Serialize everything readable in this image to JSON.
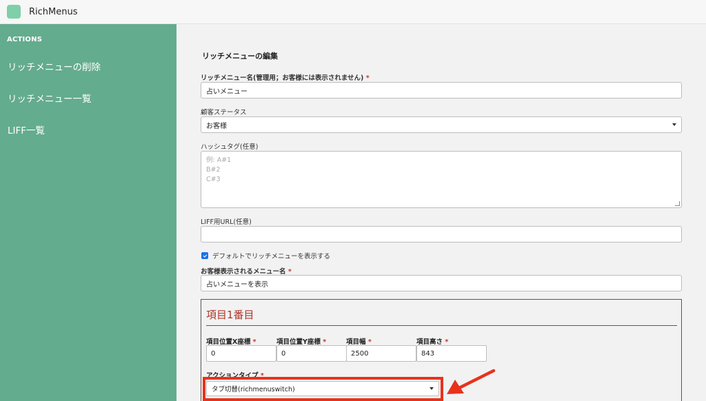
{
  "app": {
    "title": "RichMenus"
  },
  "sidebar": {
    "heading": "ACTIONS",
    "items": [
      {
        "label": "リッチメニューの削除"
      },
      {
        "label": "リッチメニュー一覧"
      },
      {
        "label": "LIFF一覧"
      }
    ]
  },
  "form": {
    "title": "リッチメニューの編集",
    "name": {
      "label": "リッチメニュー名(管理用；お客様には表示されません)",
      "required": "*",
      "value": "占いメニュー"
    },
    "status": {
      "label": "顧客ステータス",
      "value": "お客様"
    },
    "hashtag": {
      "label": "ハッシュタグ(任意)",
      "placeholder_lines": [
        "例: A#1",
        "B#2",
        "C#3"
      ]
    },
    "liff_url": {
      "label": "LIFF用URL(任意)",
      "value": ""
    },
    "default_checkbox": {
      "label": "デフォルトでリッチメニューを表示する",
      "checked": true
    },
    "display_name": {
      "label": "お客様表示されるメニュー名",
      "required": "*",
      "value": "占いメニューを表示"
    },
    "item1": {
      "title": "項目1番目",
      "fields": [
        {
          "label": "項目位置X座標",
          "required": "*",
          "value": "0"
        },
        {
          "label": "項目位置Y座標",
          "required": "*",
          "value": "0"
        },
        {
          "label": "項目幅",
          "required": "*",
          "value": "2500"
        },
        {
          "label": "項目高さ",
          "required": "*",
          "value": "843"
        }
      ],
      "action_type": {
        "label": "アクションタイプ",
        "required": "*",
        "value": "タブ切替(richmenuswitch)"
      }
    }
  },
  "colors": {
    "sidebar": "#64ac8e",
    "logo": "#7fcfa8",
    "accent_red": "#b0352a",
    "highlight": "#e8321b",
    "checkbox": "#1a73e8"
  }
}
